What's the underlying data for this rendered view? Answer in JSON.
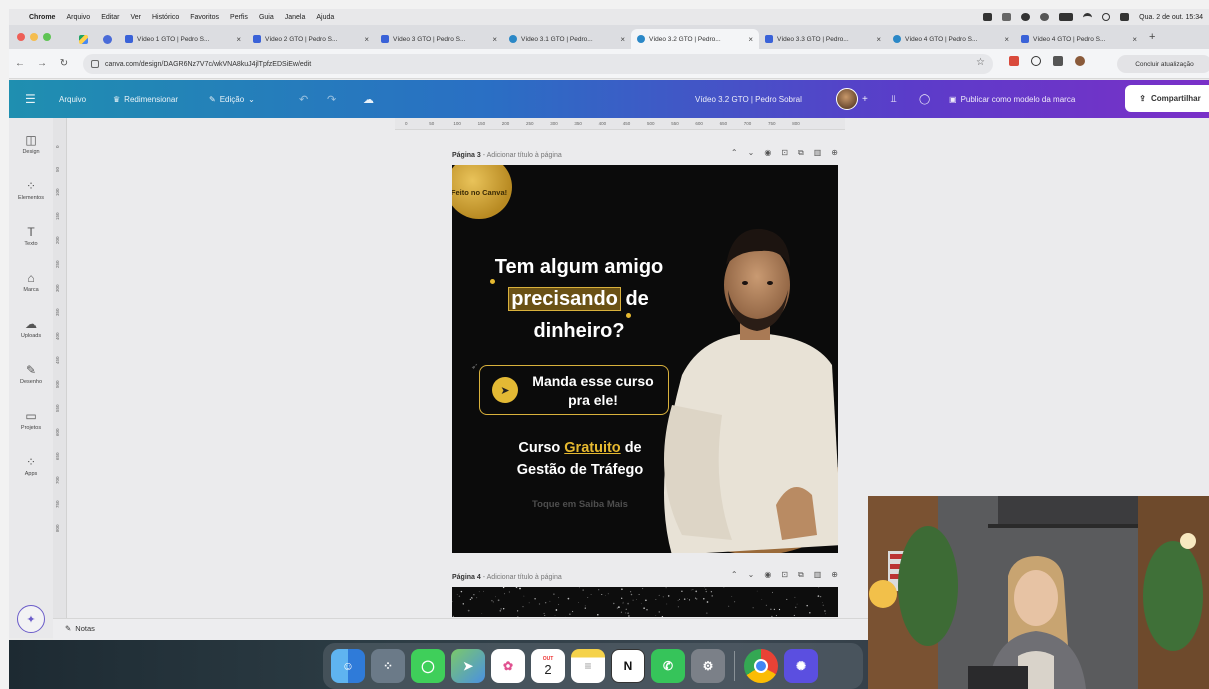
{
  "menubar": {
    "items": [
      "Chrome",
      "Arquivo",
      "Editar",
      "Ver",
      "Histórico",
      "Favoritos",
      "Perfis",
      "Guia",
      "Janela",
      "Ajuda"
    ],
    "clock": "Qua. 2 de out. 15:34"
  },
  "tabs": [
    {
      "title": "Vídeo 1 GTO | Pedro S...",
      "active": false
    },
    {
      "title": "Vídeo 2 GTO | Pedro S...",
      "active": false
    },
    {
      "title": "Vídeo 3 GTO | Pedro S...",
      "active": false
    },
    {
      "title": "Vídeo 3.1 GTO | Pedro...",
      "active": false
    },
    {
      "title": "Vídeo 3.2 GTO | Pedro...",
      "active": true
    },
    {
      "title": "Vídeo 3.3 GTO | Pedro...",
      "active": false
    },
    {
      "title": "Vídeo 4 GTO | Pedro S...",
      "active": false
    },
    {
      "title": "Vídeo 4 GTO | Pedro S...",
      "active": false
    }
  ],
  "address": {
    "url": "canva.com/design/DAGR6Nz7V7c/wkVNA8kuJ4jlTpfzEDSiEw/edit",
    "update_label": "Concluir atualização"
  },
  "canva": {
    "file_label": "Arquivo",
    "resize_label": "Redimensionar",
    "edit_label": "Edição",
    "doc_title": "Vídeo 3.2 GTO | Pedro Sobral",
    "publish_label": "Publicar como modelo da marca",
    "share_label": "Compartilhar"
  },
  "sidebar": [
    {
      "label": "Design",
      "icon": "design-icon"
    },
    {
      "label": "Elementos",
      "icon": "elements-icon"
    },
    {
      "label": "Texto",
      "icon": "text-icon"
    },
    {
      "label": "Marca",
      "icon": "brand-icon"
    },
    {
      "label": "Uploads",
      "icon": "upload-icon"
    },
    {
      "label": "Desenho",
      "icon": "draw-icon"
    },
    {
      "label": "Projetos",
      "icon": "folder-icon"
    },
    {
      "label": "Apps",
      "icon": "apps-icon"
    }
  ],
  "ruler": {
    "h_ticks": [
      "0",
      "50",
      "100",
      "150",
      "200",
      "250",
      "300",
      "350",
      "400",
      "450",
      "500",
      "550",
      "600",
      "650",
      "700",
      "750",
      "800"
    ],
    "v_ticks": [
      "0",
      "50",
      "100",
      "150",
      "200",
      "250",
      "300",
      "350",
      "400",
      "450",
      "500",
      "550",
      "600",
      "650",
      "700",
      "750",
      "800"
    ]
  },
  "page3": {
    "label": "Página 3",
    "sub": "- Adicionar título à página",
    "badge": "Feito no Canva!",
    "line1": "Tem algum amigo",
    "line2_highlight": "precisando",
    "line2_rest": " de",
    "line3": "dinheiro?",
    "cta": "Manda esse curso pra ele!",
    "course_a": "Curso ",
    "course_gold": "Gratuito",
    "course_b": " de",
    "course_c": "Gestão de Tráfego",
    "touch": "Toque em Saiba Mais"
  },
  "page4": {
    "label": "Página 4",
    "sub": "- Adicionar título à página"
  },
  "notes_label": "Notas",
  "dock_calendar": {
    "month": "OUT",
    "day": "2"
  },
  "colors": {
    "header_start": "#1f8fb0",
    "header_end": "#7a30c8",
    "accent_gold": "#e6b930",
    "design_bg": "#0b0b0b"
  }
}
